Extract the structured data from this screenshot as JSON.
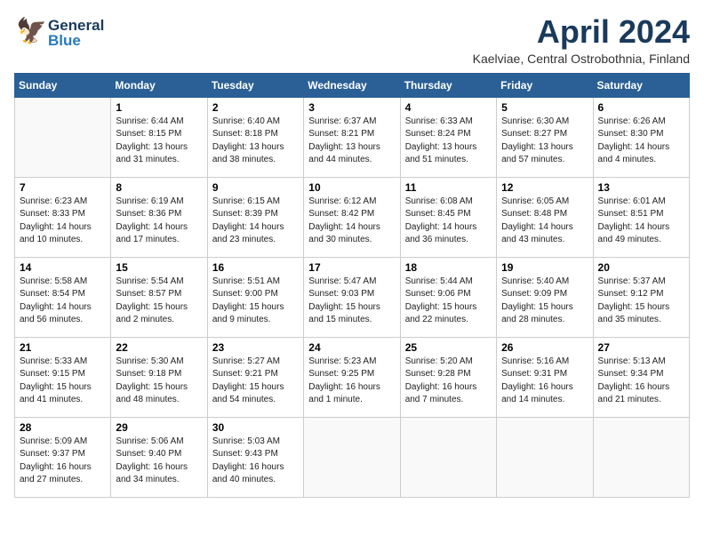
{
  "header": {
    "logo_general": "General",
    "logo_blue": "Blue",
    "title": "April 2024",
    "subtitle": "Kaelviae, Central Ostrobothnia, Finland"
  },
  "calendar": {
    "days_of_week": [
      "Sunday",
      "Monday",
      "Tuesday",
      "Wednesday",
      "Thursday",
      "Friday",
      "Saturday"
    ],
    "weeks": [
      [
        {
          "day": "",
          "info": ""
        },
        {
          "day": "1",
          "info": "Sunrise: 6:44 AM\nSunset: 8:15 PM\nDaylight: 13 hours\nand 31 minutes."
        },
        {
          "day": "2",
          "info": "Sunrise: 6:40 AM\nSunset: 8:18 PM\nDaylight: 13 hours\nand 38 minutes."
        },
        {
          "day": "3",
          "info": "Sunrise: 6:37 AM\nSunset: 8:21 PM\nDaylight: 13 hours\nand 44 minutes."
        },
        {
          "day": "4",
          "info": "Sunrise: 6:33 AM\nSunset: 8:24 PM\nDaylight: 13 hours\nand 51 minutes."
        },
        {
          "day": "5",
          "info": "Sunrise: 6:30 AM\nSunset: 8:27 PM\nDaylight: 13 hours\nand 57 minutes."
        },
        {
          "day": "6",
          "info": "Sunrise: 6:26 AM\nSunset: 8:30 PM\nDaylight: 14 hours\nand 4 minutes."
        }
      ],
      [
        {
          "day": "7",
          "info": "Sunrise: 6:23 AM\nSunset: 8:33 PM\nDaylight: 14 hours\nand 10 minutes."
        },
        {
          "day": "8",
          "info": "Sunrise: 6:19 AM\nSunset: 8:36 PM\nDaylight: 14 hours\nand 17 minutes."
        },
        {
          "day": "9",
          "info": "Sunrise: 6:15 AM\nSunset: 8:39 PM\nDaylight: 14 hours\nand 23 minutes."
        },
        {
          "day": "10",
          "info": "Sunrise: 6:12 AM\nSunset: 8:42 PM\nDaylight: 14 hours\nand 30 minutes."
        },
        {
          "day": "11",
          "info": "Sunrise: 6:08 AM\nSunset: 8:45 PM\nDaylight: 14 hours\nand 36 minutes."
        },
        {
          "day": "12",
          "info": "Sunrise: 6:05 AM\nSunset: 8:48 PM\nDaylight: 14 hours\nand 43 minutes."
        },
        {
          "day": "13",
          "info": "Sunrise: 6:01 AM\nSunset: 8:51 PM\nDaylight: 14 hours\nand 49 minutes."
        }
      ],
      [
        {
          "day": "14",
          "info": "Sunrise: 5:58 AM\nSunset: 8:54 PM\nDaylight: 14 hours\nand 56 minutes."
        },
        {
          "day": "15",
          "info": "Sunrise: 5:54 AM\nSunset: 8:57 PM\nDaylight: 15 hours\nand 2 minutes."
        },
        {
          "day": "16",
          "info": "Sunrise: 5:51 AM\nSunset: 9:00 PM\nDaylight: 15 hours\nand 9 minutes."
        },
        {
          "day": "17",
          "info": "Sunrise: 5:47 AM\nSunset: 9:03 PM\nDaylight: 15 hours\nand 15 minutes."
        },
        {
          "day": "18",
          "info": "Sunrise: 5:44 AM\nSunset: 9:06 PM\nDaylight: 15 hours\nand 22 minutes."
        },
        {
          "day": "19",
          "info": "Sunrise: 5:40 AM\nSunset: 9:09 PM\nDaylight: 15 hours\nand 28 minutes."
        },
        {
          "day": "20",
          "info": "Sunrise: 5:37 AM\nSunset: 9:12 PM\nDaylight: 15 hours\nand 35 minutes."
        }
      ],
      [
        {
          "day": "21",
          "info": "Sunrise: 5:33 AM\nSunset: 9:15 PM\nDaylight: 15 hours\nand 41 minutes."
        },
        {
          "day": "22",
          "info": "Sunrise: 5:30 AM\nSunset: 9:18 PM\nDaylight: 15 hours\nand 48 minutes."
        },
        {
          "day": "23",
          "info": "Sunrise: 5:27 AM\nSunset: 9:21 PM\nDaylight: 15 hours\nand 54 minutes."
        },
        {
          "day": "24",
          "info": "Sunrise: 5:23 AM\nSunset: 9:25 PM\nDaylight: 16 hours\nand 1 minute."
        },
        {
          "day": "25",
          "info": "Sunrise: 5:20 AM\nSunset: 9:28 PM\nDaylight: 16 hours\nand 7 minutes."
        },
        {
          "day": "26",
          "info": "Sunrise: 5:16 AM\nSunset: 9:31 PM\nDaylight: 16 hours\nand 14 minutes."
        },
        {
          "day": "27",
          "info": "Sunrise: 5:13 AM\nSunset: 9:34 PM\nDaylight: 16 hours\nand 21 minutes."
        }
      ],
      [
        {
          "day": "28",
          "info": "Sunrise: 5:09 AM\nSunset: 9:37 PM\nDaylight: 16 hours\nand 27 minutes."
        },
        {
          "day": "29",
          "info": "Sunrise: 5:06 AM\nSunset: 9:40 PM\nDaylight: 16 hours\nand 34 minutes."
        },
        {
          "day": "30",
          "info": "Sunrise: 5:03 AM\nSunset: 9:43 PM\nDaylight: 16 hours\nand 40 minutes."
        },
        {
          "day": "",
          "info": ""
        },
        {
          "day": "",
          "info": ""
        },
        {
          "day": "",
          "info": ""
        },
        {
          "day": "",
          "info": ""
        }
      ]
    ]
  }
}
